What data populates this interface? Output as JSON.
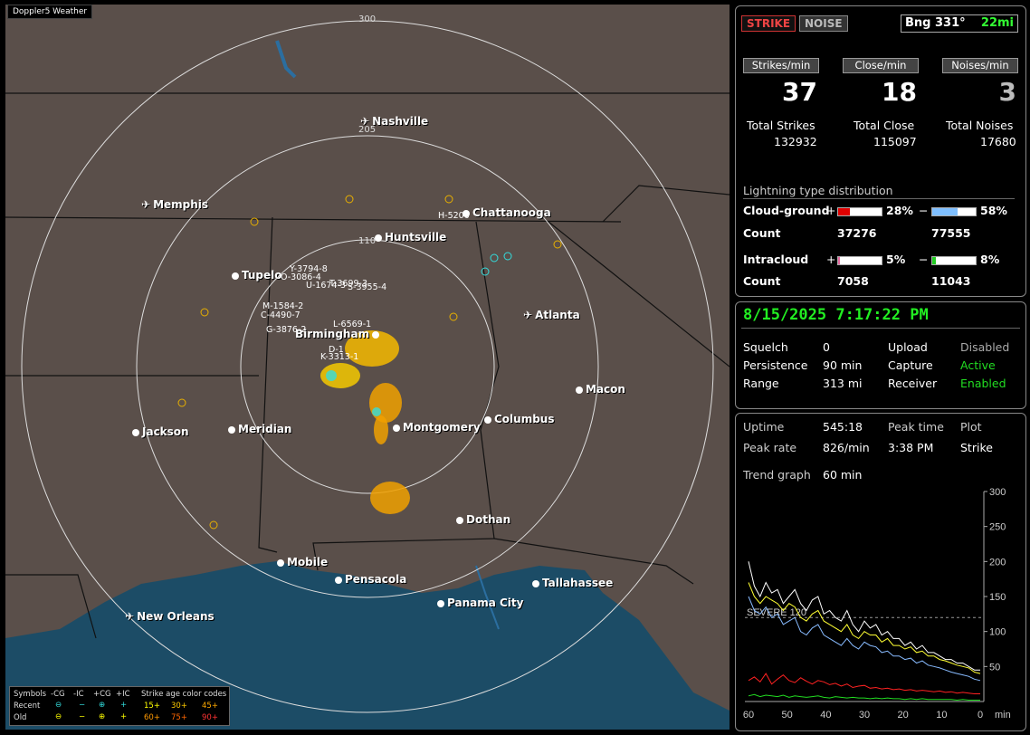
{
  "map": {
    "app_badge": "Doppler5 Weather",
    "ring_labels": [
      "300",
      "205",
      "110"
    ],
    "cities": [
      {
        "name": "Nashville",
        "icon": "airport"
      },
      {
        "name": "Memphis",
        "icon": "airport"
      },
      {
        "name": "Chattanooga",
        "icon": "dot"
      },
      {
        "name": "Huntsville",
        "icon": "dot"
      },
      {
        "name": "Tupelo",
        "icon": "dot"
      },
      {
        "name": "Atlanta",
        "icon": "airport"
      },
      {
        "name": "Birmingham",
        "icon": "dot"
      },
      {
        "name": "Macon",
        "icon": "dot"
      },
      {
        "name": "Jackson",
        "icon": "dot"
      },
      {
        "name": "Meridian",
        "icon": "dot"
      },
      {
        "name": "Montgomery",
        "icon": "dot"
      },
      {
        "name": "Columbus",
        "icon": "dot"
      },
      {
        "name": "Dothan",
        "icon": "dot"
      },
      {
        "name": "Mobile",
        "icon": "dot"
      },
      {
        "name": "Pensacola",
        "icon": "dot"
      },
      {
        "name": "Tallahassee",
        "icon": "dot"
      },
      {
        "name": "Panama City",
        "icon": "dot"
      },
      {
        "name": "New Orleans",
        "icon": "airport"
      }
    ],
    "storm_labels": [
      "H-5200",
      "Y-3794-8",
      "O-3086-4",
      "U-1674-3",
      "T-3699-3",
      "S-3955-4",
      "M-1584-2",
      "C-4490-7",
      "G-3876-2",
      "L-6569-1",
      "D-1",
      "K-3313-1"
    ],
    "legend": {
      "symbols_label": "Symbols",
      "col_headers": [
        "-CG",
        "-IC",
        "+CG",
        "+IC"
      ],
      "age_header": "Strike age color codes",
      "recent_label": "Recent",
      "old_label": "Old",
      "recent_ages": [
        "15+",
        "30+",
        "45+"
      ],
      "old_ages": [
        "60+",
        "75+",
        "90+"
      ]
    }
  },
  "panel": {
    "strike_btn": "STRIKE",
    "noise_btn": "NOISE",
    "bearing": "Bng 331°",
    "distance": "22mi",
    "rates": [
      {
        "header": "Strikes/min",
        "value": "37",
        "total_label": "Total Strikes",
        "total": "132932"
      },
      {
        "header": "Close/min",
        "value": "18",
        "total_label": "Total Close",
        "total": "115097"
      },
      {
        "header": "Noises/min",
        "value": "3",
        "total_label": "Total Noises",
        "total": "17680"
      }
    ],
    "dist_title": "Lightning type distribution",
    "cg_label": "Cloud-ground",
    "ic_label": "Intracloud",
    "count_label": "Count",
    "plus": "+",
    "minus": "−",
    "cg_pos_pct": "28%",
    "cg_pos_frac": 0.28,
    "cg_neg_pct": "58%",
    "cg_neg_frac": 0.58,
    "cg_pos_count": "37276",
    "cg_neg_count": "77555",
    "ic_pos_pct": "5%",
    "ic_pos_frac": 0.05,
    "ic_neg_pct": "8%",
    "ic_neg_frac": 0.08,
    "ic_pos_count": "7058",
    "ic_neg_count": "11043",
    "colors": {
      "cg_pos": "#e00000",
      "cg_neg": "#7fbfff",
      "ic_pos": "#e66aa0",
      "ic_neg": "#22cc22",
      "accent_green": "#22dd22"
    }
  },
  "status": {
    "datetime": "8/15/2025 7:17:22 PM",
    "squelch_label": "Squelch",
    "squelch": "0",
    "persistence_label": "Persistence",
    "persistence": "90 min",
    "range_label": "Range",
    "range": "313 mi",
    "upload_label": "Upload",
    "upload": "Disabled",
    "capture_label": "Capture",
    "capture": "Active",
    "receiver_label": "Receiver",
    "receiver": "Enabled"
  },
  "stats": {
    "uptime_label": "Uptime",
    "uptime": "545:18",
    "peak_time_label": "Peak time",
    "peak_time": "3:38 PM",
    "plot_label": "Plot",
    "plot": "Strike",
    "peak_rate_label": "Peak rate",
    "peak_rate": "826/min",
    "trend_label": "Trend graph",
    "trend": "60 min"
  },
  "chart_data": {
    "type": "line",
    "x_unit": "min",
    "x_ticks": [
      "60",
      "50",
      "40",
      "30",
      "20",
      "10",
      "0"
    ],
    "y_ticks": [
      "300",
      "250",
      "200",
      "150",
      "100",
      "50"
    ],
    "ylim": [
      0,
      300
    ],
    "threshold": {
      "label": "SEVERE 120",
      "value": 120
    },
    "series": [
      {
        "color": "#ffffff",
        "values": [
          200,
          165,
          150,
          170,
          155,
          160,
          140,
          150,
          160,
          140,
          130,
          145,
          150,
          125,
          130,
          120,
          115,
          130,
          110,
          100,
          115,
          105,
          110,
          95,
          100,
          90,
          90,
          80,
          85,
          75,
          80,
          70,
          70,
          65,
          60,
          60,
          55,
          55,
          50,
          45,
          45
        ]
      },
      {
        "color": "#ffff33",
        "values": [
          170,
          150,
          140,
          150,
          145,
          140,
          130,
          140,
          135,
          120,
          115,
          125,
          130,
          115,
          110,
          105,
          100,
          110,
          95,
          90,
          100,
          95,
          95,
          85,
          90,
          80,
          80,
          75,
          78,
          70,
          72,
          65,
          65,
          60,
          58,
          55,
          52,
          50,
          48,
          42,
          40
        ]
      },
      {
        "color": "#88bbff",
        "values": [
          150,
          130,
          125,
          135,
          120,
          125,
          110,
          115,
          120,
          100,
          95,
          105,
          110,
          95,
          90,
          85,
          80,
          90,
          80,
          75,
          85,
          80,
          78,
          70,
          72,
          65,
          65,
          60,
          62,
          55,
          58,
          52,
          50,
          48,
          45,
          42,
          40,
          38,
          36,
          32,
          30
        ]
      },
      {
        "color": "#ff2222",
        "values": [
          30,
          35,
          28,
          40,
          25,
          32,
          38,
          30,
          27,
          34,
          29,
          25,
          30,
          28,
          24,
          26,
          22,
          25,
          20,
          22,
          23,
          19,
          20,
          18,
          19,
          17,
          18,
          16,
          17,
          15,
          16,
          15,
          14,
          15,
          13,
          14,
          12,
          13,
          12,
          11,
          11
        ]
      },
      {
        "color": "#22dd22",
        "values": [
          8,
          10,
          7,
          9,
          8,
          7,
          9,
          6,
          8,
          7,
          6,
          7,
          8,
          6,
          5,
          7,
          6,
          5,
          6,
          5,
          5,
          4,
          5,
          4,
          5,
          4,
          4,
          3,
          4,
          3,
          4,
          3,
          3,
          3,
          3,
          3,
          2,
          3,
          2,
          2,
          2
        ]
      }
    ]
  }
}
